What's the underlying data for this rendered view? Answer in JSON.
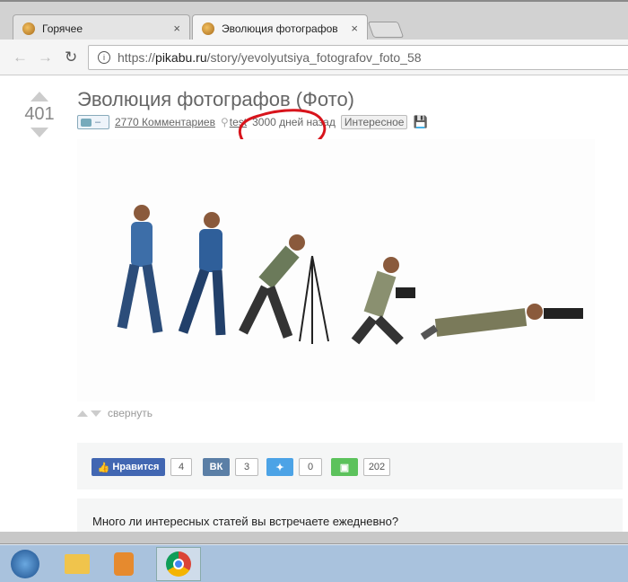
{
  "browser": {
    "tabs": [
      {
        "title": "Горячее",
        "close": "×"
      },
      {
        "title": "Эволюция фотографов",
        "close": "×"
      }
    ],
    "url_scheme": "https://",
    "url_domain": "pikabu.ru",
    "url_path": "/story/yevolyutsiya_fotografov_foto_58"
  },
  "post": {
    "rating": "401",
    "title": "Эволюция фотографов (Фото)",
    "photo_badge": "–",
    "comments": "2770 Комментариев",
    "author": "test",
    "time": "3000 дней назад",
    "tag": "Интересное",
    "collapse": "свернуть",
    "annotation_color": "#d8141c"
  },
  "share": {
    "fb_label": "Нравится",
    "fb_count": "4",
    "vk_label": "ВК",
    "vk_count": "3",
    "tw_count": "0",
    "save_count": "202"
  },
  "poll": {
    "question": "Много ли интересных статей вы встречаете ежедневно?"
  }
}
